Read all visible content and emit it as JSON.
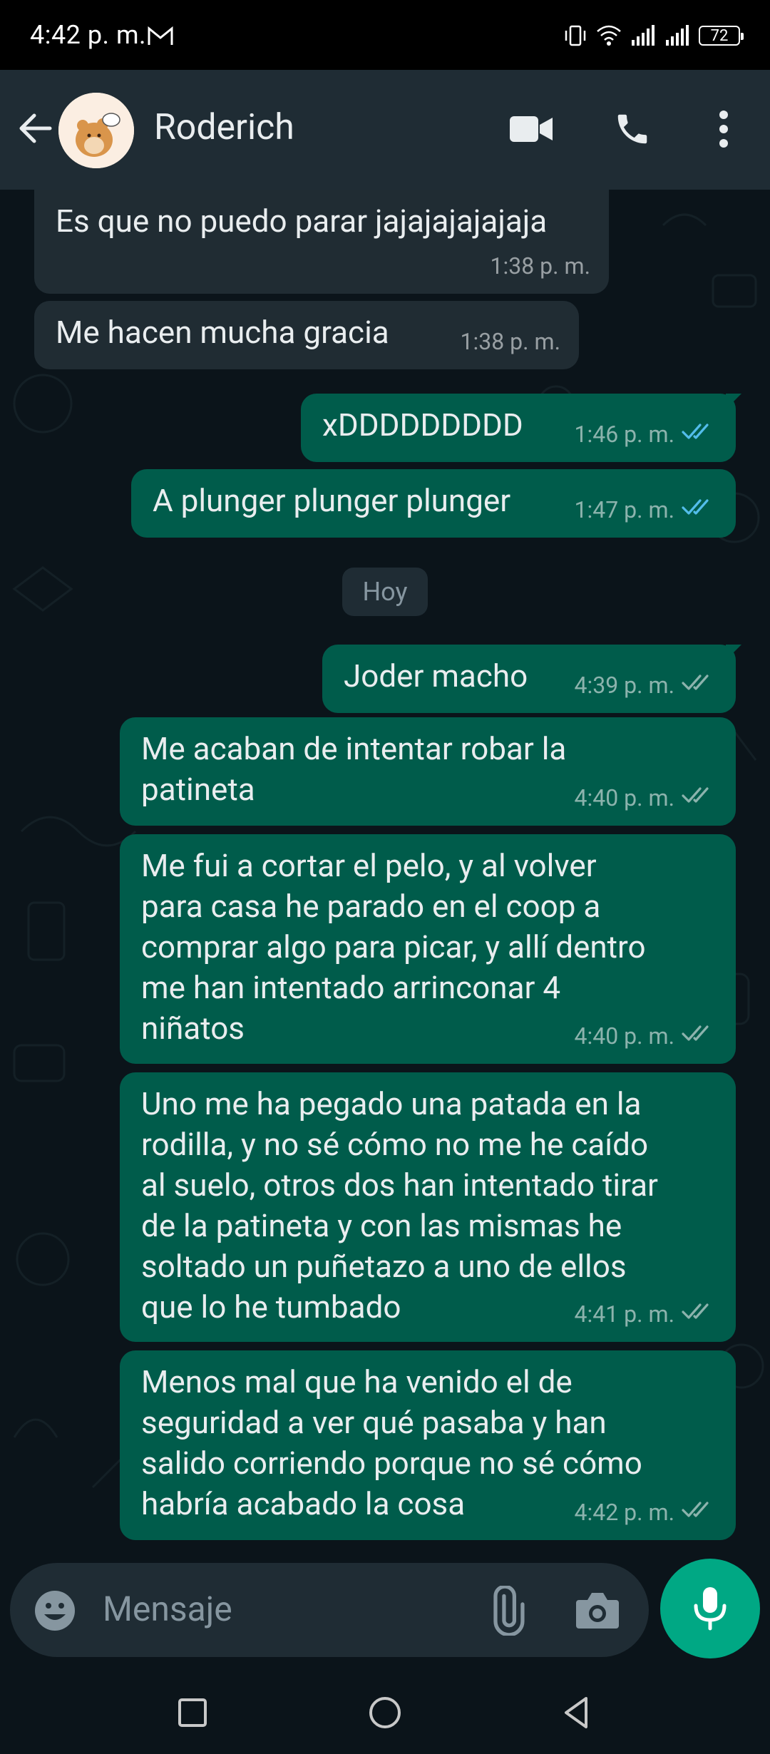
{
  "status_bar": {
    "time": "4:42 p. m.",
    "battery": "72"
  },
  "header": {
    "contact_name": "Roderich"
  },
  "messages": [
    {
      "dir": "in",
      "text": "Es que no puedo parar jajajajajajaja",
      "time": "1:38 p. m."
    },
    {
      "dir": "in",
      "text": "Me hacen mucha gracia",
      "time": "1:38 p. m."
    },
    {
      "dir": "out",
      "text": "xDDDDDDDDD",
      "time": "1:46 p. m.",
      "status": "read"
    },
    {
      "dir": "out",
      "text": "A plunger plunger plunger",
      "time": "1:47 p. m.",
      "status": "read"
    },
    {
      "dir": "out",
      "text": "Joder macho",
      "time": "4:39 p. m.",
      "status": "delivered"
    },
    {
      "dir": "out",
      "text": "Me acaban de intentar robar la\npatineta",
      "time": "4:40 p. m.",
      "status": "delivered"
    },
    {
      "dir": "out",
      "text": "Me fui a cortar el pelo, y al volver\npara casa he parado en el coop a\ncomprar algo para picar, y allí dentro\nme han intentado arrinconar 4\nniñatos",
      "time": "4:40 p. m.",
      "status": "delivered"
    },
    {
      "dir": "out",
      "text": "Uno me ha pegado una patada en la\nrodilla, y no sé cómo no me he caído\nal suelo, otros dos han intentado tirar\nde la patineta y con las mismas he\nsoltado un puñetazo a uno de ellos\nque lo he tumbado",
      "time": "4:41 p. m.",
      "status": "delivered"
    },
    {
      "dir": "out",
      "text": "Menos mal que ha venido el de\nseguridad a ver qué pasaba y han\nsalido corriendo porque no sé cómo\nhabría acabado la cosa",
      "time": "4:42 p. m.",
      "status": "delivered"
    }
  ],
  "date_divider": "Hoy",
  "input": {
    "placeholder": "Mensaje"
  },
  "colors": {
    "accent": "#00a884",
    "read_tick": "#53bdeb",
    "out_bubble": "#005c4b",
    "in_bubble": "#202c33"
  },
  "icons": [
    "back-arrow-icon",
    "video-call-icon",
    "phone-icon",
    "more-vert-icon",
    "emoji-icon",
    "attach-icon",
    "camera-icon",
    "mic-icon",
    "nav-recents-icon",
    "nav-home-icon",
    "nav-back-icon"
  ]
}
